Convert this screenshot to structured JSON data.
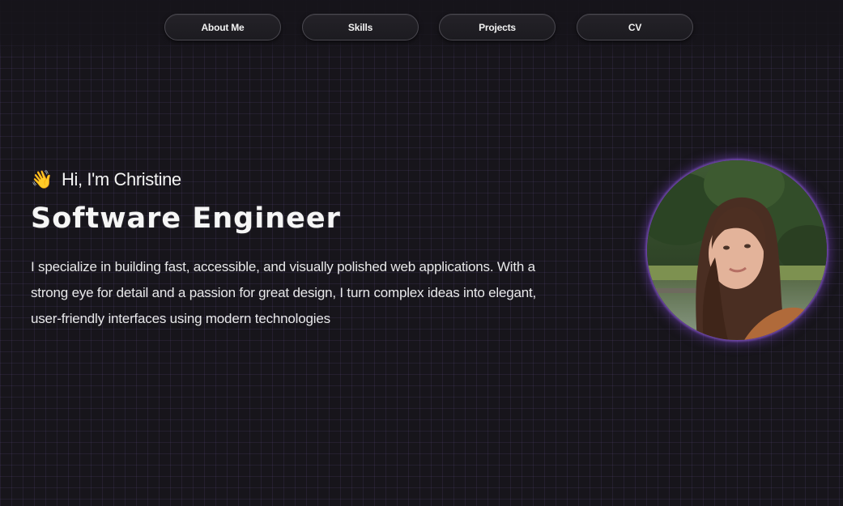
{
  "nav": {
    "items": [
      {
        "label": "About Me"
      },
      {
        "label": "Skills"
      },
      {
        "label": "Projects"
      },
      {
        "label": "CV"
      }
    ]
  },
  "hero": {
    "wave_emoji": "👋",
    "greeting": "Hi, I'm Christine",
    "title": "Software Engineer",
    "intro": "I specialize in building fast, accessible, and visually polished web applications. With a strong eye for detail and a passion for great design, I turn complex ideas into elegant, user-friendly interfaces using modern technologies"
  },
  "avatar": {
    "icon": "profile-photo",
    "glow_color": "#7a46c8"
  },
  "colors": {
    "background": "#17151b",
    "grid": "#3a3350",
    "text": "#f4f4f4",
    "nav_border": "#4a4850"
  }
}
